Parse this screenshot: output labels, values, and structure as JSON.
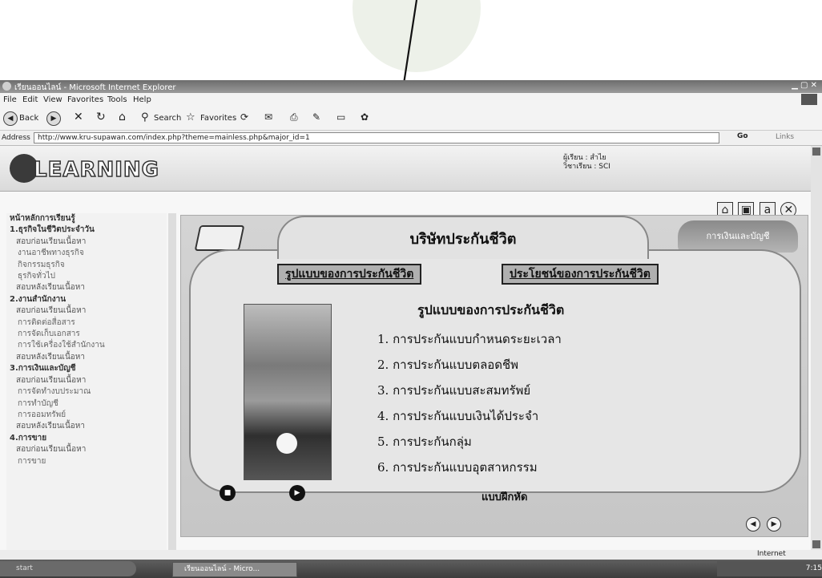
{
  "browser": {
    "title": "เรียนออนไลน์ - Microsoft Internet Explorer",
    "menu": [
      "File",
      "Edit",
      "View",
      "Favorites",
      "Tools",
      "Help"
    ],
    "toolbar": {
      "back": "Back",
      "search": "Search",
      "favorites": "Favorites"
    },
    "address_label": "Address",
    "url": "http://www.kru-supawan.com/index.php?theme=mainless.php&major_id=1",
    "go": "Go",
    "links": "Links"
  },
  "site": {
    "logo": "LEARNING",
    "user_label": "ผู้เรียน : สำไย",
    "subject_label": "วิชาเรียน : SCI"
  },
  "sidebar": {
    "items": [
      {
        "label": "หน้าหลักการเรียนรู้",
        "level": "sec"
      },
      {
        "label": "1.ธุรกิจในชีวิตประจำวัน",
        "level": "sec"
      },
      {
        "label": "สอบก่อนเรียนเนื้อหา",
        "level": "sub"
      },
      {
        "label": "งานอาชีพทางธุรกิจ",
        "level": "sub2"
      },
      {
        "label": "กิจกรรมธุรกิจ",
        "level": "sub2"
      },
      {
        "label": "ธุรกิจทั่วไป",
        "level": "sub2"
      },
      {
        "label": "สอบหลังเรียนเนื้อหา",
        "level": "sub"
      },
      {
        "label": "2.งานสำนักงาน",
        "level": "sec"
      },
      {
        "label": "สอบก่อนเรียนเนื้อหา",
        "level": "sub"
      },
      {
        "label": "การติดต่อสื่อสาร",
        "level": "sub2"
      },
      {
        "label": "การจัดเก็บเอกสาร",
        "level": "sub2"
      },
      {
        "label": "การใช้เครื่องใช้สำนักงาน",
        "level": "sub2"
      },
      {
        "label": "สอบหลังเรียนเนื้อหา",
        "level": "sub"
      },
      {
        "label": "3.การเงินและบัญชี",
        "level": "sec"
      },
      {
        "label": "สอบก่อนเรียนเนื้อหา",
        "level": "sub"
      },
      {
        "label": "การจัดทำงบประมาณ",
        "level": "sub2"
      },
      {
        "label": "การทำบัญชี",
        "level": "sub2"
      },
      {
        "label": "การออมทรัพย์",
        "level": "sub2"
      },
      {
        "label": "สอบหลังเรียนเนื้อหา",
        "level": "sub"
      },
      {
        "label": "4.การขาย",
        "level": "sec"
      },
      {
        "label": "สอบก่อนเรียนเนื้อหา",
        "level": "sub"
      },
      {
        "label": "การขาย",
        "level": "sub2"
      }
    ]
  },
  "content": {
    "header_title": "บริษัทประกันชีวิต",
    "right_tab": "การเงินและบัญชี",
    "tab_forms": "รูปแบบของการประกันชีวิต",
    "tab_benefits": "ประโยชน์ของการประกันชีวิต",
    "list_title": "รูปแบบของการประกันชีวิต",
    "list": [
      "1. การประกันแบบกำหนดระยะเวลา",
      "2. การประกันแบบตลอดชีพ",
      "3. การประกันแบบสะสมทรัพย์",
      "4. การประกันแบบเงินได้ประจำ",
      "5. การประกันกลุ่ม",
      "6. การประกันแบบอุตสาหกรรม"
    ],
    "practice": "แบบฝึกหัด"
  },
  "status": {
    "zone": "Internet"
  },
  "taskbar": {
    "start": "start",
    "tasks": [
      "เรียนออนไลน์ - Micro..."
    ],
    "tray_time": "7:15"
  },
  "colors": {
    "page_bg": "#f7f7f7",
    "board": "#e6e6e6",
    "tab_button": "#b0b0b0"
  }
}
